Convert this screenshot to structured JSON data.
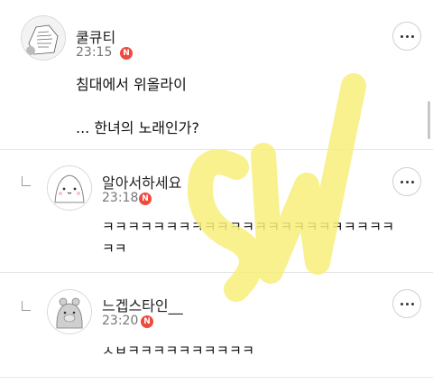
{
  "comments": [
    {
      "author": "쿨큐티",
      "time": "23:15",
      "badge": "N",
      "lines": [
        "침대에서 위올라이",
        "... 한녀의 노래인가?"
      ]
    },
    {
      "author": "알아서하세요",
      "time": "23:18",
      "badge": "N",
      "lines": [
        "ㅋㅋㅋㅋㅋㅋㅋㅋㅋㅋㅋㅋㅋㅋㅋㅋㅋㅋㅋㅋㅋㅋㅋ",
        "ㅋㅋ"
      ]
    },
    {
      "author": "느겝스타인__",
      "time": "23:20",
      "badge": "N",
      "lines": [
        "ㅅㅂㅋㅋㅋㅋㅋㅋㅋㅋㅋㅋ"
      ]
    }
  ],
  "colors": {
    "badge": "#f04a3f",
    "watermark": "#f7ef7a"
  },
  "icons": {
    "more": "more-options-icon",
    "reply": "reply-indent-icon",
    "badge": "new-badge-icon"
  }
}
